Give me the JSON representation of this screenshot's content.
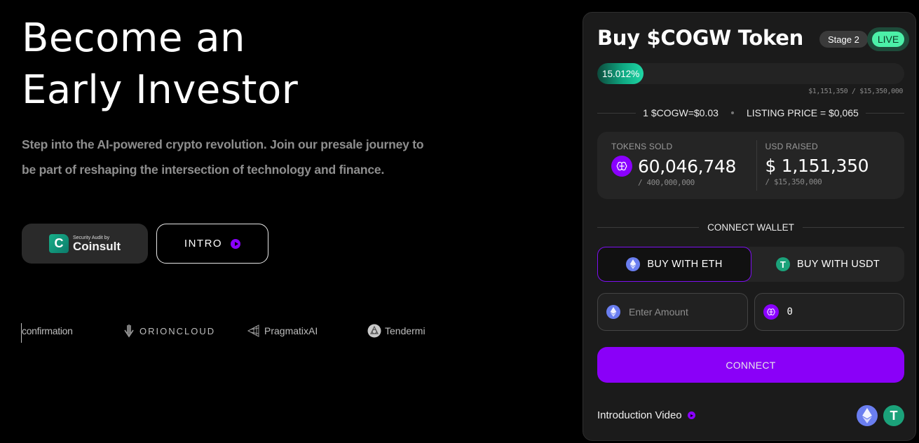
{
  "hero": {
    "title_line1": "Become an",
    "title_line2": "Early Investor",
    "subtitle": "Step into the AI-powered crypto revolution. Join our presale journey to be part of reshaping the intersection of technology and finance."
  },
  "buttons": {
    "audit_small": "Security Audit by",
    "audit_brand": "Coinsult",
    "intro_label": "INTRO"
  },
  "partners": [
    {
      "name": "confirmation",
      "icon": "bracket-icon"
    },
    {
      "name": "ORIONCLOUD",
      "icon": "orion-arrow-icon"
    },
    {
      "name": "PragmatixAI",
      "icon": "pragmatix-mesh-icon"
    },
    {
      "name": "Tendermi",
      "icon": "tendermint-icon"
    }
  ],
  "presale": {
    "title": "Buy $COGW Token",
    "stage": "Stage 2",
    "status": "LIVE",
    "progress_percent": 15.012,
    "progress_label": "15.012%",
    "progress_caption": "$1,151,350 / $15,350,000",
    "price_text": "1 $COGW=$0.03",
    "listing_text": "LISTING PRICE = $0,065",
    "tokens_sold_label": "TOKENS SOLD",
    "tokens_sold_value": "60,046,748",
    "tokens_sold_total": "/ 400,000,000",
    "usd_raised_label": "USD RAISED",
    "usd_raised_value": "$ 1,151,350",
    "usd_raised_total": "/ $15,350,000",
    "connect_wallet_label": "CONNECT WALLET",
    "buy_eth_label": "BUY WITH ETH",
    "buy_usdt_label": "BUY WITH USDT",
    "amount_placeholder": "Enter Amount",
    "amount_value": "",
    "receive_value": "0",
    "connect_button": "CONNECT",
    "intro_video_label": "Introduction Video"
  },
  "colors": {
    "accent_purple": "#8a00f8",
    "live_green": "#4cf0a8",
    "progress_green": "#1fd7a5",
    "eth_blue": "#6a7ef0",
    "usdt_green": "#1ba27a"
  }
}
